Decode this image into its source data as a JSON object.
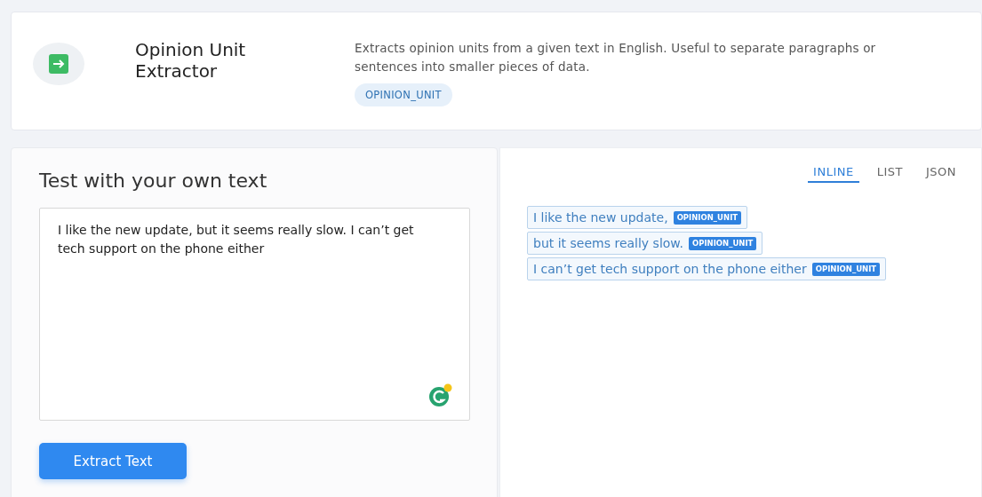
{
  "header": {
    "title": "Opinion Unit\nExtractor",
    "description": "Extracts opinion units from a given text in English. Useful to separate paragraphs or sentences into smaller pieces of data.",
    "tag": "OPINION_UNIT"
  },
  "input_panel": {
    "heading": "Test with your own text",
    "value": "I like the new update, but it seems really slow. I can’t get tech support on the phone either",
    "button": "Extract Text"
  },
  "view_tabs": [
    {
      "label": "INLINE",
      "selected": true
    },
    {
      "label": "LIST",
      "selected": false
    },
    {
      "label": "JSON",
      "selected": false
    }
  ],
  "results": [
    {
      "text": "I like the new update,",
      "tag": "OPINION_UNIT"
    },
    {
      "text": "but it seems really slow.",
      "tag": "OPINION_UNIT"
    },
    {
      "text": "I can’t get tech support on the phone either",
      "tag": "OPINION_UNIT"
    }
  ]
}
